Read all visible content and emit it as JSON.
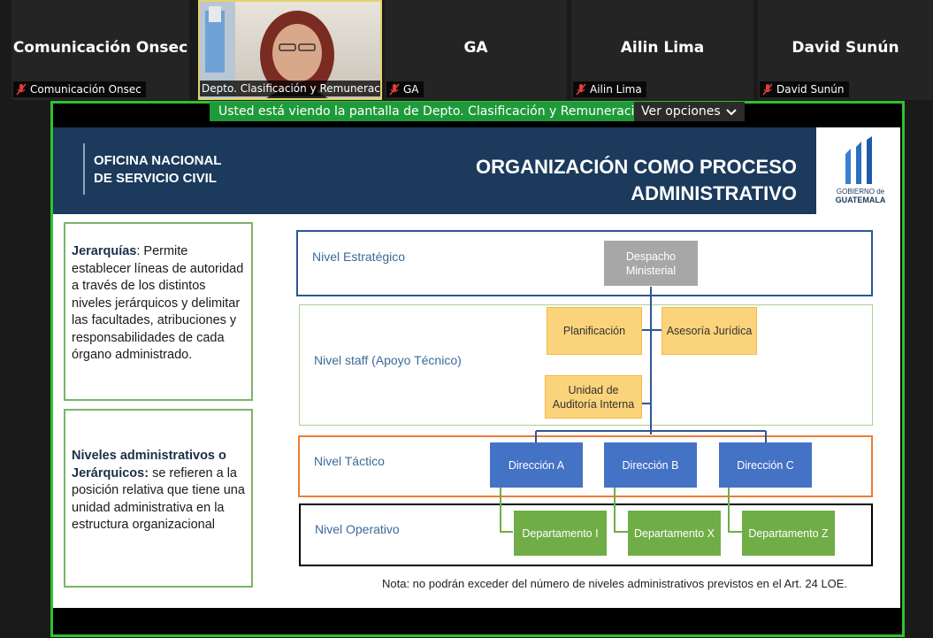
{
  "participants": [
    {
      "name": "Comunicación Onsec",
      "label": "Comunicación Onsec",
      "muted": true
    },
    {
      "name": "",
      "label": "Depto. Clasificación y Remuneraci...",
      "muted": false,
      "video": true
    },
    {
      "name": "GA",
      "label": "GA",
      "muted": true
    },
    {
      "name": "Ailin Lima",
      "label": "Ailin Lima",
      "muted": true
    },
    {
      "name": "David Sunún",
      "label": "David Sunún",
      "muted": true
    }
  ],
  "share": {
    "banner": "Usted está viendo la pantalla de Depto. Clasificación y Remuneracio",
    "options": "Ver opciones"
  },
  "slide": {
    "org_line1": "OFICINA NACIONAL",
    "org_line2": "DE SERVICIO CIVIL",
    "title_line1": "ORGANIZACIÓN COMO PROCESO",
    "title_line2": "ADMINISTRATIVO",
    "logo_line1": "GOBIERNO de",
    "logo_line2": "GUATEMALA",
    "box1_term": "Jerarquías",
    "box1_text": ":  Permite establecer líneas de autoridad a través de los distintos niveles jerárquicos y delimitar las facultades, atribuciones y responsabilidades de cada órgano administrado.",
    "box2_term": "Niveles administrativos o Jerárquicos:",
    "box2_text": " se refieren a la posición relativa que tiene una unidad administrativa en la estructura organizacional",
    "levels": {
      "estrategico": "Nivel Estratégico",
      "staff": "Nivel staff (Apoyo Técnico)",
      "tactico": "Nivel Táctico",
      "operativo": "Nivel Operativo"
    },
    "nodes": {
      "despacho_1": "Despacho",
      "despacho_2": "Ministerial",
      "planificacion": "Planificación",
      "asesoria": "Asesoría Jurídica",
      "auditoria_1": "Unidad de",
      "auditoria_2": "Auditoría Interna",
      "dir_a": "Dirección A",
      "dir_b": "Dirección B",
      "dir_c": "Dirección C",
      "dep_i": "Departamento I",
      "dep_x": "Departamento X",
      "dep_z": "Departamento Z"
    },
    "note": "Nota: no podrán exceder del número de niveles administrativos previstos en el Art. 24 LOE."
  },
  "colors": {
    "share_border": "#2fc12f",
    "header_bg": "#1b3a5c",
    "level_strategic": "#2f5597",
    "level_staff": "#a9d18e",
    "level_tactic": "#ed7d31",
    "level_operative": "#000000"
  }
}
